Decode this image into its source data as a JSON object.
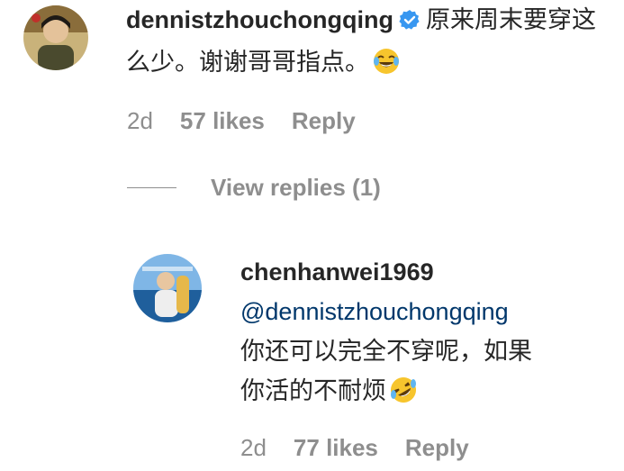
{
  "comment": {
    "username": "dennistzhouchongqing",
    "text": "原来周末要穿这么少。谢谢哥哥指点。",
    "emoji": "face-with-tears-of-joy",
    "time": "2d",
    "likes": "57 likes",
    "reply_label": "Reply",
    "view_replies": "View replies (1)"
  },
  "reply": {
    "username": "chenhanwei1969",
    "mention": "@dennistzhouchongqing",
    "text_line1": "你还可以完全不穿呢，如果",
    "text_line2": "你活的不耐烦",
    "emoji": "rolling-on-the-floor-laughing",
    "time": "2d",
    "likes": "77 likes",
    "reply_label": "Reply"
  },
  "colors": {
    "text": "#262626",
    "secondary": "#8e8e8e",
    "mention": "#00376b",
    "verified": "#3897f0"
  }
}
